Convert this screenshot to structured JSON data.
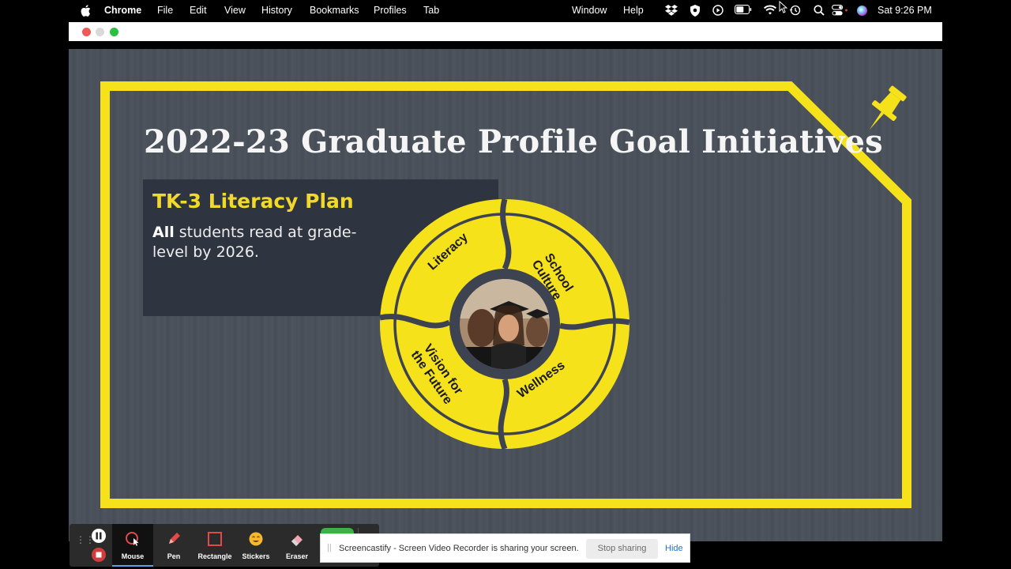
{
  "menubar": {
    "app": "Chrome",
    "items": [
      "File",
      "Edit",
      "View",
      "History",
      "Bookmarks",
      "Profiles",
      "Tab"
    ],
    "right_items": [
      "Window",
      "Help"
    ],
    "clock": "Sat  9:26 PM",
    "icons": [
      "apple-icon",
      "dropbox-icon",
      "shield-icon",
      "play-icon",
      "battery-icon",
      "wifi-icon",
      "time-machine-icon",
      "search-icon",
      "control-center-icon",
      "siri-icon"
    ]
  },
  "slide": {
    "title": "2022-23 Graduate Profile Goal Initiatives",
    "panel": {
      "heading": "TK-3 Literacy Plan",
      "body_bold": "All",
      "body_rest": " students read at grade-level by 2026."
    },
    "wheel": {
      "segments": [
        "Literacy",
        "School\nCulture",
        "Vision for\nthe Future",
        "Wellness"
      ]
    }
  },
  "toolbar": {
    "items": [
      "Mouse",
      "Pen",
      "Rectangle",
      "Stickers",
      "Eraser"
    ]
  },
  "share_banner": {
    "text": "Screencastify - Screen Video Recorder is sharing your screen.",
    "stop_label": "Stop sharing",
    "hide_label": "Hide"
  },
  "colors": {
    "accent_yellow": "#f6e21a",
    "slide_bg": "#4b515a",
    "panel_bg": "#2f3540",
    "heading_yellow": "#f2d82a",
    "hide_blue": "#1a73e8"
  }
}
